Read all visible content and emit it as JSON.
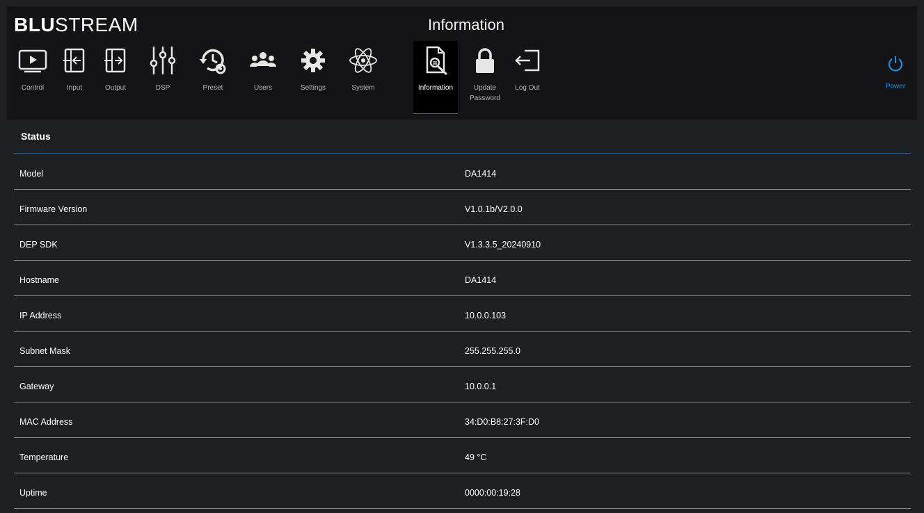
{
  "brand": {
    "logo_bold": "BLU",
    "logo_light": "STREAM"
  },
  "header": {
    "title": "Information"
  },
  "nav": {
    "items": [
      {
        "label": "Control",
        "icon": "monitor-play-icon"
      },
      {
        "label": "Input",
        "icon": "input-icon"
      },
      {
        "label": "Output",
        "icon": "output-icon"
      },
      {
        "label": "DSP",
        "icon": "dsp-sliders-icon"
      },
      {
        "label": "Preset",
        "icon": "preset-history-icon"
      },
      {
        "label": "Users",
        "icon": "users-icon"
      },
      {
        "label": "Settings",
        "icon": "gear-icon"
      },
      {
        "label": "System",
        "icon": "atom-icon"
      },
      {
        "label": "Information",
        "icon": "document-search-icon",
        "active": true
      },
      {
        "label": "Update\nPassword",
        "icon": "lock-icon"
      },
      {
        "label": "Log Out",
        "icon": "logout-icon"
      }
    ],
    "power_label": "Power"
  },
  "colors": {
    "accent": "#1e8fe1",
    "background": "#1f2022",
    "header_bg": "#141416",
    "divider": "#2e5d8c"
  },
  "status": {
    "heading": "Status",
    "rows": [
      {
        "key": "Model",
        "value": "DA1414"
      },
      {
        "key": "Firmware Version",
        "value": "V1.0.1b/V2.0.0"
      },
      {
        "key": "DEP SDK",
        "value": "V1.3.3.5_20240910"
      },
      {
        "key": "Hostname",
        "value": "DA1414"
      },
      {
        "key": "IP Address",
        "value": "10.0.0.103"
      },
      {
        "key": "Subnet Mask",
        "value": "255.255.255.0"
      },
      {
        "key": "Gateway",
        "value": "10.0.0.1"
      },
      {
        "key": "MAC Address",
        "value": "34:D0:B8:27:3F:D0"
      },
      {
        "key": "Temperature",
        "value": "49 °C"
      },
      {
        "key": "Uptime",
        "value": "0000:00:19:28"
      }
    ]
  }
}
